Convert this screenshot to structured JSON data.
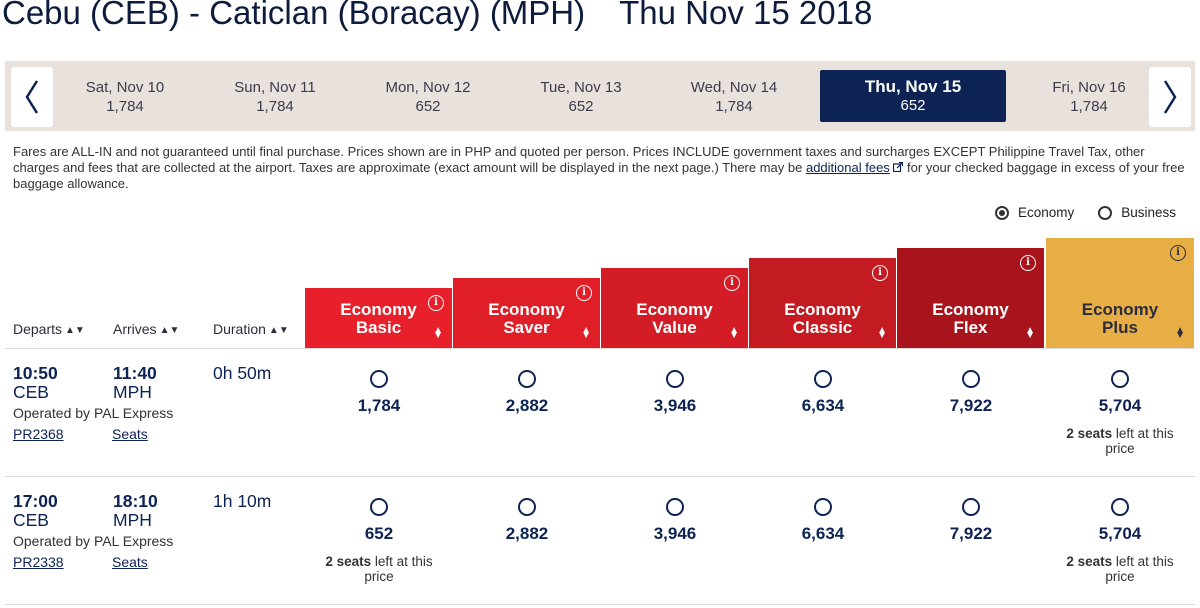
{
  "header": {
    "route": "Cebu (CEB) - Caticlan (Boracay) (MPH)",
    "date": "Thu Nov 15 2018"
  },
  "date_bar": {
    "prev_icon": "chevron-left-icon",
    "next_icon": "chevron-right-icon",
    "dates": [
      {
        "day": "Sat, Nov 10",
        "price": "1,784"
      },
      {
        "day": "Sun, Nov 11",
        "price": "1,784"
      },
      {
        "day": "Mon, Nov 12",
        "price": "652"
      },
      {
        "day": "Tue, Nov 13",
        "price": "652"
      },
      {
        "day": "Wed, Nov 14",
        "price": "1,784"
      },
      {
        "day": "Thu, Nov 15",
        "price": "652"
      },
      {
        "day": "Fri, Nov 16",
        "price": "1,784"
      }
    ],
    "active_index": 5
  },
  "notice": {
    "text_before": "Fares are ALL-IN and not guaranteed until final purchase. Prices shown are in PHP and quoted per person. Prices INCLUDE government taxes and surcharges EXCEPT Philippine Travel Tax, other charges and fees that are collected at the airport. Taxes are approximate (exact amount will be displayed in the next page.) There may be ",
    "link": "additional fees",
    "link_icon": "external-link-icon",
    "text_after": " for your checked baggage in excess of your free baggage allowance."
  },
  "cabin": {
    "options": [
      {
        "label": "Economy",
        "selected": true
      },
      {
        "label": "Business",
        "selected": false
      }
    ]
  },
  "columns": {
    "departs": "Departs",
    "arrives": "Arrives",
    "duration": "Duration",
    "sort_icon": "sort-icon"
  },
  "fare_classes": [
    {
      "line1": "Economy",
      "line2": "Basic",
      "color": "#e8202b"
    },
    {
      "line1": "Economy",
      "line2": "Saver",
      "color": "#e01e28"
    },
    {
      "line1": "Economy",
      "line2": "Value",
      "color": "#d31c25"
    },
    {
      "line1": "Economy",
      "line2": "Classic",
      "color": "#c41a22"
    },
    {
      "line1": "Economy",
      "line2": "Flex",
      "color": "#a9141c"
    },
    {
      "line1": "Economy",
      "line2": "Plus",
      "color": "#e6ae44"
    }
  ],
  "flights": [
    {
      "depart_time": "10:50",
      "depart_code": "CEB",
      "arrive_time": "11:40",
      "arrive_code": "MPH",
      "duration": "0h 50m",
      "operated": "Operated by PAL Express",
      "flight_no": "PR2368",
      "seats_link": "Seats",
      "fares": [
        "1,784",
        "2,882",
        "3,946",
        "6,634",
        "7,922",
        "5,704"
      ],
      "notes": [
        null,
        null,
        null,
        null,
        null,
        {
          "count": "2 seats",
          "rest1": " left at this",
          "rest2": "price"
        }
      ]
    },
    {
      "depart_time": "17:00",
      "depart_code": "CEB",
      "arrive_time": "18:10",
      "arrive_code": "MPH",
      "duration": "1h 10m",
      "operated": "Operated by PAL Express",
      "flight_no": "PR2338",
      "seats_link": "Seats",
      "fares": [
        "652",
        "2,882",
        "3,946",
        "6,634",
        "7,922",
        "5,704"
      ],
      "notes": [
        {
          "count": "2 seats",
          "rest1": " left at this",
          "rest2": "price"
        },
        null,
        null,
        null,
        null,
        {
          "count": "2 seats",
          "rest1": " left at this",
          "rest2": "price"
        }
      ]
    }
  ]
}
